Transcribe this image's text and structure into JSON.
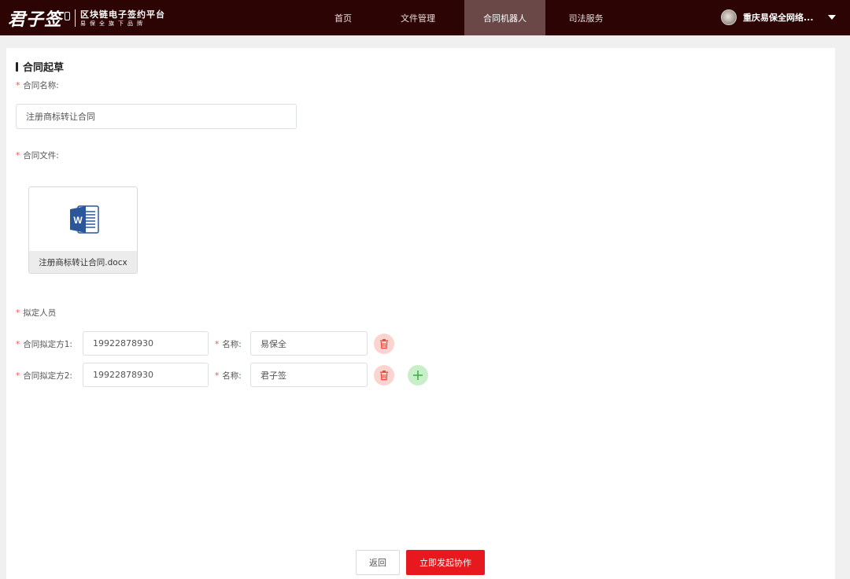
{
  "header": {
    "logo_main": "君子签",
    "logo_line1": "区块链电子签约平台",
    "logo_line2": "易保全旗下品牌",
    "nav": [
      {
        "label": "首页"
      },
      {
        "label": "文件管理"
      },
      {
        "label": "合同机器人",
        "active": true
      },
      {
        "label": "司法服务"
      }
    ],
    "user_name": "重庆易保全网络...",
    "bg_color": "#2d0404",
    "active_color": "#6a4848"
  },
  "form": {
    "section_title": "合同起草",
    "required_mark": "*",
    "contract_name_label": "合同名称:",
    "contract_name_value": "注册商标转让合同",
    "contract_file_label": "合同文件:",
    "file_name": "注册商标转让合同.docx",
    "drafters_label": "拟定人员",
    "parties": [
      {
        "label": "合同拟定方1:",
        "phone": "19922878930",
        "name_label": "名称:",
        "name": "易保全"
      },
      {
        "label": "合同拟定方2:",
        "phone": "19922878930",
        "name_label": "名称:",
        "name": "君子签"
      }
    ]
  },
  "actions": {
    "back_label": "返回",
    "submit_label": "立即发起协作",
    "primary_color": "#e8191e"
  },
  "icons": {
    "file": "word-doc-icon",
    "delete": "trash-icon",
    "add": "plus-icon",
    "user_menu": "caret-down-icon"
  }
}
